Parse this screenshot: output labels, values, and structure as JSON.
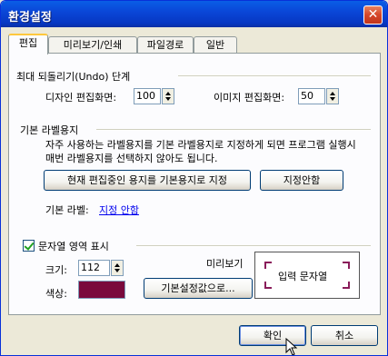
{
  "window": {
    "title": "환경설정",
    "close_label": "✕"
  },
  "tabs": [
    {
      "label": "편집",
      "active": true
    },
    {
      "label": "미리보기/인쇄",
      "active": false
    },
    {
      "label": "파일경로",
      "active": false
    },
    {
      "label": "일반",
      "active": false
    }
  ],
  "undo": {
    "group_label": "최대 되돌리기(Undo) 단계",
    "design_label": "디자인 편집화면:",
    "design_value": "100",
    "image_label": "이미지 편집화면:",
    "image_value": "50"
  },
  "label_paper": {
    "group_label": "기본 라벨용지",
    "description": "자주 사용하는 라벨용지를 기본 라벨용지로 지정하게 되면 프로그램 실행시 매번 라벨용지를 선택하지 않아도 됩니다.",
    "set_default_button": "현재 편집중인 용지를 기본용지로 지정",
    "unset_button": "지정안함",
    "default_label": "기본 라벨:",
    "default_value": "지정 안함"
  },
  "text_area": {
    "checkbox_label": "문자열 영역 표시",
    "checked": true,
    "size_label": "크기:",
    "size_value": "112",
    "color_label": "색상:",
    "color_value": "#7a0a3c",
    "defaults_button": "기본설정값으로...",
    "preview_label": "미리보기",
    "preview_text": "입력 문자열"
  },
  "footer": {
    "ok_label": "확인",
    "cancel_label": "취소"
  }
}
